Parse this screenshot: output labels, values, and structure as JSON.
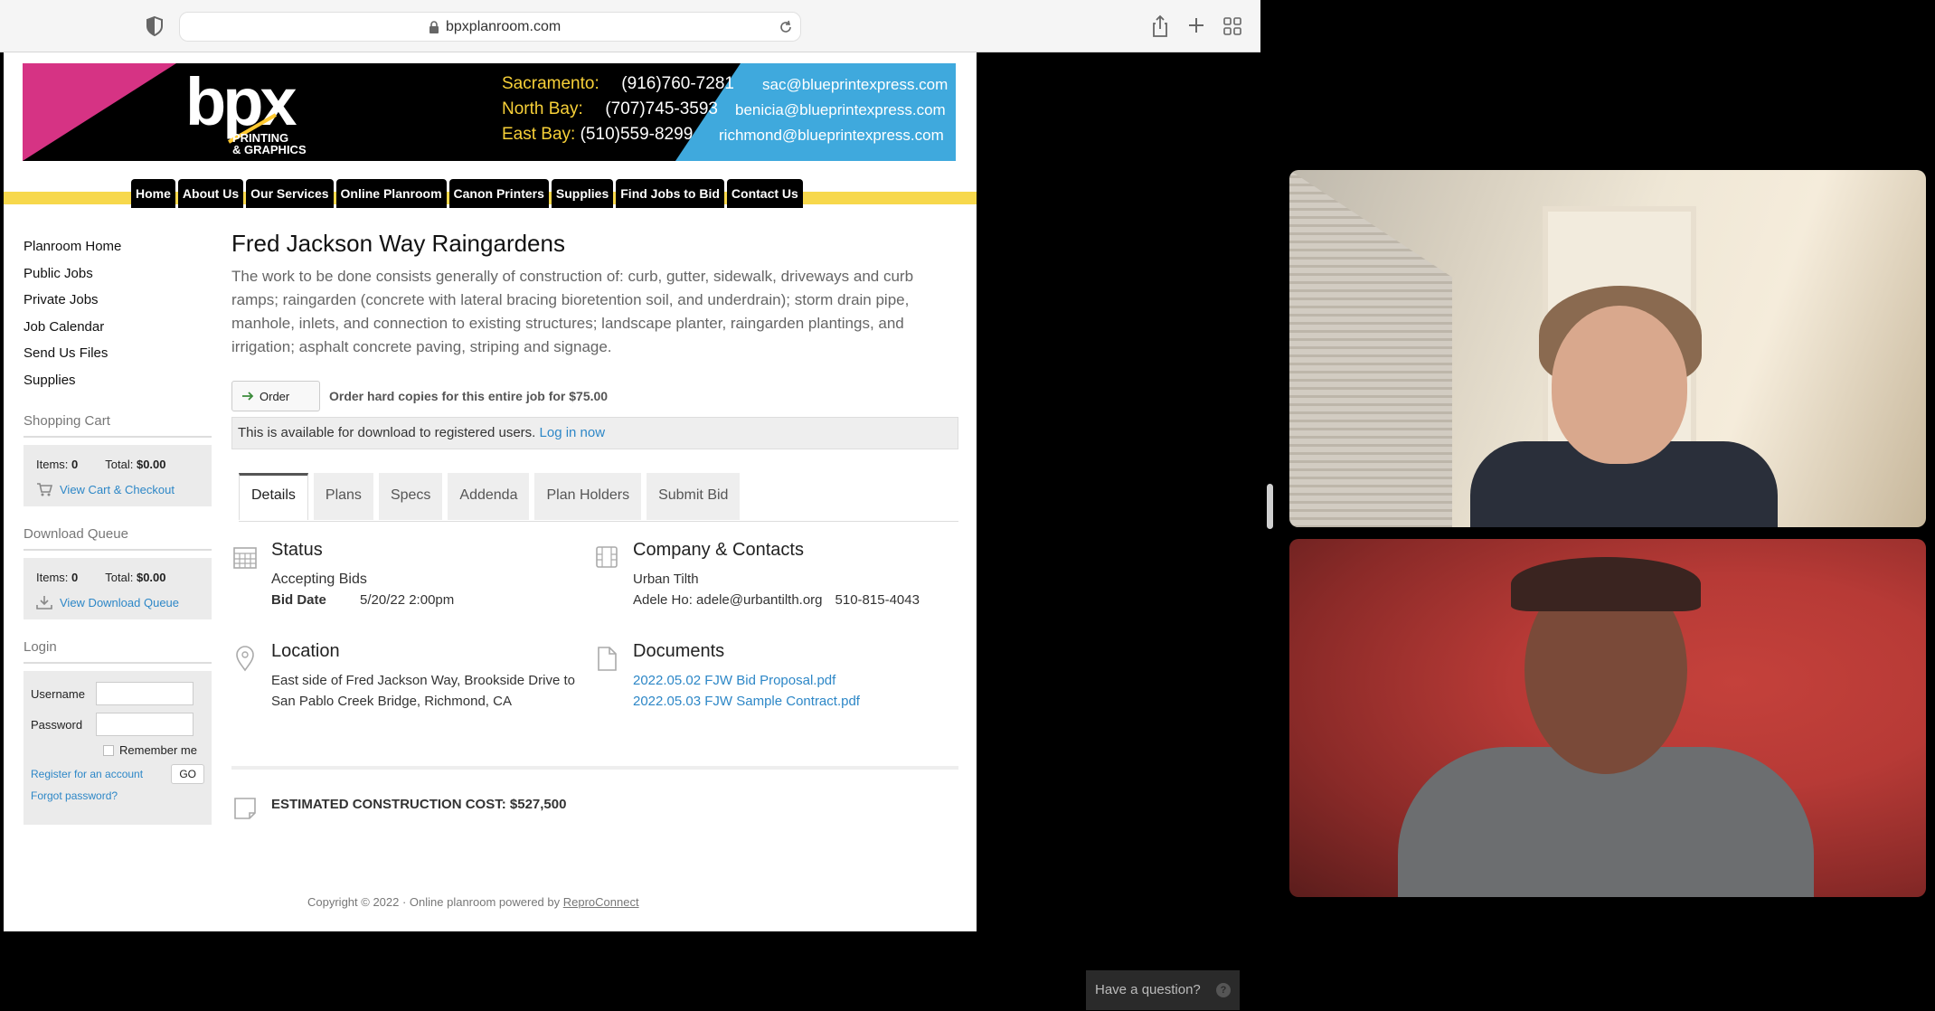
{
  "browser": {
    "url": "bpxplanroom.com"
  },
  "banner": {
    "logo": "bpx",
    "logo_sub1": "PRINTING",
    "logo_sub2": "& GRAPHICS",
    "rows": [
      {
        "city": "Sacramento:",
        "phone": "(916)760-7281",
        "email": "sac@blueprintexpress.com"
      },
      {
        "city": "North Bay:",
        "phone": "(707)745-3593",
        "email": "benicia@blueprintexpress.com"
      },
      {
        "city": "East Bay:",
        "phone": "(510)559-8299",
        "email": "richmond@blueprintexpress.com"
      }
    ]
  },
  "nav": [
    "Home",
    "About Us",
    "Our Services",
    "Online Planroom",
    "Canon Printers",
    "Supplies",
    "Find Jobs to Bid",
    "Contact Us"
  ],
  "sidebar": {
    "links": [
      "Planroom Home",
      "Public Jobs",
      "Private Jobs",
      "Job Calendar",
      "Send Us Files",
      "Supplies"
    ],
    "cart": {
      "heading": "Shopping Cart",
      "items_label": "Items:",
      "items": "0",
      "total_label": "Total:",
      "total": "$0.00",
      "link": "View Cart & Checkout"
    },
    "queue": {
      "heading": "Download Queue",
      "items_label": "Items:",
      "items": "0",
      "total_label": "Total:",
      "total": "$0.00",
      "link": "View Download Queue"
    },
    "login": {
      "heading": "Login",
      "username": "Username",
      "password": "Password",
      "remember": "Remember me",
      "register": "Register for an account",
      "go": "GO",
      "forgot": "Forgot password?"
    }
  },
  "job": {
    "title": "Fred Jackson Way Raingardens",
    "description": "The work to be done consists generally of construction of: curb, gutter, sidewalk, driveways and curb ramps; raingarden (concrete with lateral bracing bioretention soil, and underdrain); storm drain pipe, manhole, inlets, and connection to existing structures; landscape planter, raingarden plantings, and irrigation; asphalt concrete paving, striping and signage.",
    "order_label": "Order",
    "order_text": "Order hard copies for this entire job for $75.00",
    "notice": "This is available for download to registered users.",
    "login_link": "Log in now",
    "tabs": [
      "Details",
      "Plans",
      "Specs",
      "Addenda",
      "Plan Holders",
      "Submit Bid"
    ],
    "status": {
      "heading": "Status",
      "value": "Accepting Bids",
      "bid_label": "Bid Date",
      "bid_date": "5/20/22 2:00pm"
    },
    "company": {
      "heading": "Company & Contacts",
      "name": "Urban Tilth",
      "contact": "Adele Ho: adele@urbantilth.org",
      "phone": "510-815-4043"
    },
    "location": {
      "heading": "Location",
      "line1": "East side of Fred Jackson Way, Brookside Drive to",
      "line2": "San Pablo Creek Bridge, Richmond, CA"
    },
    "documents": {
      "heading": "Documents",
      "files": [
        "2022.05.02 FJW Bid Proposal.pdf",
        "2022.05.03 FJW Sample Contract.pdf"
      ]
    },
    "estimate": "ESTIMATED CONSTRUCTION COST: $527,500"
  },
  "footer": {
    "text": "Copyright © 2022  ·  Online planroom powered by",
    "link": "ReproConnect"
  },
  "help": {
    "label": "Have a question?",
    "icon": "?"
  }
}
